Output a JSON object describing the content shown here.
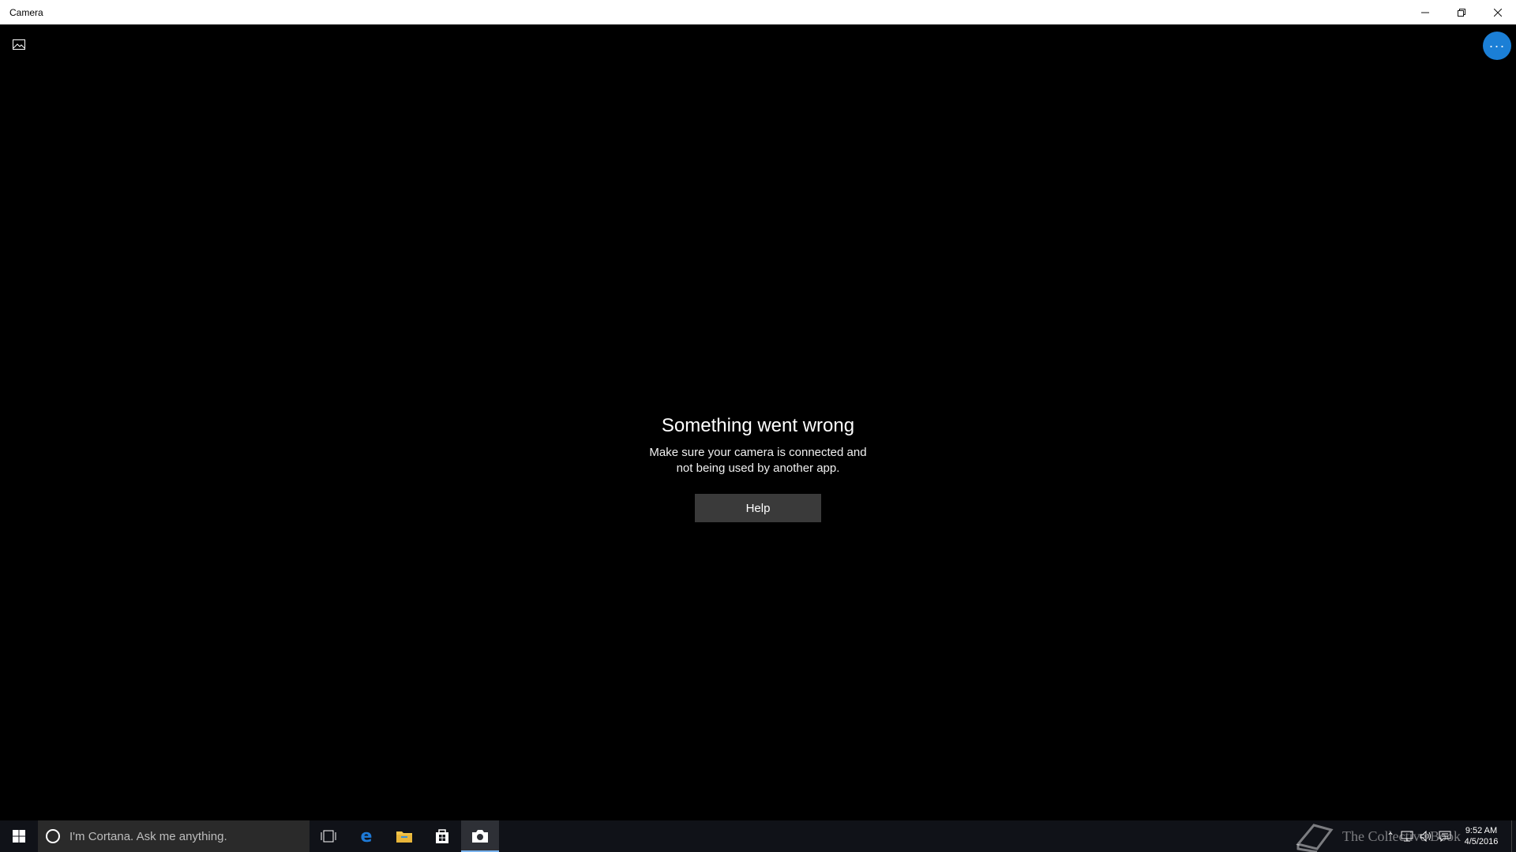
{
  "window": {
    "title": "Camera",
    "controls": {
      "minimize_icon": "minimize-icon",
      "restore_icon": "restore-icon",
      "close_icon": "close-icon"
    }
  },
  "app": {
    "gallery_icon": "photo-gallery-icon",
    "more_button_label": "···",
    "accent_color": "#1b7fd6",
    "error": {
      "title": "Something went wrong",
      "message_line1": "Make sure your camera is connected and",
      "message_line2": "not being used by another app.",
      "help_label": "Help"
    }
  },
  "taskbar": {
    "search_placeholder": "I'm Cortana. Ask me anything.",
    "pinned": [
      {
        "name": "task-view-icon"
      },
      {
        "name": "edge-icon"
      },
      {
        "name": "file-explorer-icon"
      },
      {
        "name": "store-icon"
      },
      {
        "name": "camera-app-icon",
        "active": true
      }
    ],
    "watermark_text": "The Collective Book",
    "clock": {
      "time": "9:52 AM",
      "date": "4/5/2016"
    }
  }
}
